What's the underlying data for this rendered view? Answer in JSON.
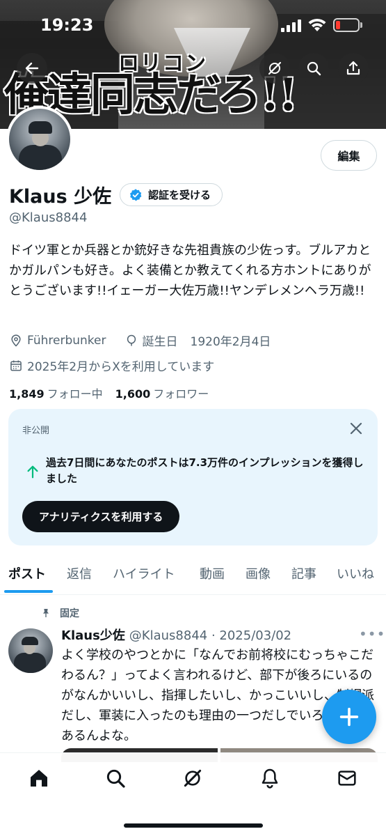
{
  "status_bar": {
    "time": "19:23"
  },
  "banner": {
    "ruby": "ロリコン",
    "caption": "俺達同志だろ!!"
  },
  "profile": {
    "display_name": "Klaus 少佐",
    "verify_label": "認証を受ける",
    "handle": "@Klaus8844",
    "edit_label": "編集",
    "bio": "ドイツ軍とか兵器とか銃好きな先祖貴族の少佐っす。ブルアカとかガルパンも好き。よく装備とか教えてくれる方ホントにありがとうございます!!イェーガー大佐万歳!!ヤンデレメンヘラ万歳!!",
    "location": "Führerbunker",
    "birthday_label": "誕生日",
    "birthday": "1920年2月4日",
    "joined": "2025年2月からXを利用しています",
    "following_count": "1,849",
    "following_label": "フォロー中",
    "followers_count": "1,600",
    "followers_label": "フォロワー"
  },
  "private_card": {
    "label": "非公開",
    "message": "過去7日間にあなたのポストは7.3万件のインプレッションを獲得しました",
    "button": "アナリティクスを利用する"
  },
  "tabs": [
    "ポスト",
    "返信",
    "ハイライト",
    "動画",
    "画像",
    "記事",
    "いいね"
  ],
  "pinned_post": {
    "pinned_label": "固定",
    "name": "Klaus少佐",
    "meta": "@Klaus8844 · 2025/03/02",
    "text": "よく学校のやつとかに「なんでお前将校にむっちゃこだわるん？」ってよく言われるけど、部下が後ろにいるのがなんかいいし、指揮したいし、かっこいいし、制帽派だし、軍装に入ったのも理由の一つだしでいろいろ理由あるんよな。"
  },
  "icons": {
    "back": "back-arrow-icon",
    "grok": "grok-icon",
    "search": "search-icon",
    "share": "share-icon",
    "verified": "verified-badge-icon",
    "location": "location-icon",
    "birthday": "balloon-icon",
    "calendar": "calendar-icon",
    "close": "close-icon",
    "arrow_up": "arrow-up-icon",
    "pin": "pin-icon",
    "compose": "plus-icon",
    "nav": [
      "home-icon",
      "search-icon",
      "grok-icon",
      "bell-icon",
      "mail-icon"
    ]
  },
  "colors": {
    "accent": "#1d9bf0",
    "text": "#0f1419",
    "secondary": "#536471",
    "private_bg": "#e8f5fd",
    "battery_low": "#ff3b30",
    "impression_arrow": "#00ba7c"
  }
}
